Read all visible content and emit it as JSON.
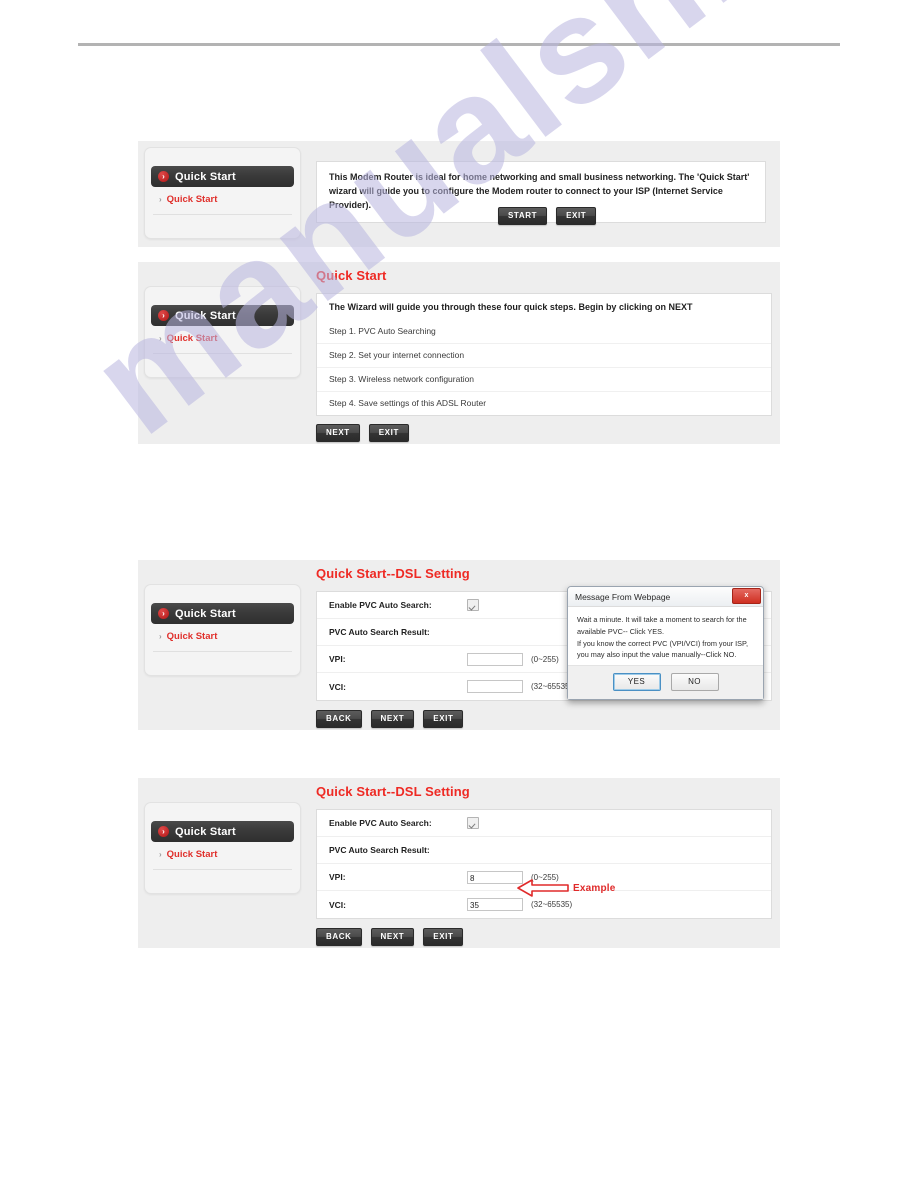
{
  "page": {
    "watermark": "manualshive.com"
  },
  "nav": {
    "main_label": "Quick Start",
    "sub_label": "Quick Start",
    "bullet": "chevron-right-icon"
  },
  "panel1": {
    "intro": "This Modem Router is ideal for home networking and small business networking. The 'Quick Start' wizard will guide you to configure the Modem router to connect to your ISP (Internet Service Provider).",
    "buttons": [
      "START",
      "EXIT"
    ]
  },
  "panel2": {
    "title": "Quick Start",
    "heading": "The Wizard will guide you through these four quick steps. Begin by clicking on NEXT",
    "steps": [
      "Step 1. PVC Auto Searching",
      "Step 2. Set your internet connection",
      "Step 3. Wireless network configuration",
      "Step 4. Save settings of this ADSL Router"
    ],
    "buttons": [
      "NEXT",
      "EXIT"
    ]
  },
  "panel3": {
    "title": "Quick Start--DSL Setting",
    "rows": {
      "enable_label": "Enable PVC Auto Search:",
      "result_label": "PVC Auto Search Result:",
      "vpi_label": "VPI:",
      "vpi_value": "",
      "vpi_range": "(0~255)",
      "vci_label": "VCI:",
      "vci_value": "",
      "vci_range": "(32~65535)"
    },
    "buttons": [
      "BACK",
      "NEXT",
      "EXIT"
    ],
    "dialog": {
      "title": "Message From Webpage",
      "close": "x",
      "line1": "Wait a minute. It will take a moment to search for the",
      "line2": "available PVC-- Click YES.",
      "line3": "If you know the correct PVC (VPI/VCI) from your ISP,",
      "line4": "you may also input the value manually--Click NO.",
      "yes": "YES",
      "no": "NO"
    }
  },
  "panel4": {
    "title": "Quick Start--DSL Setting",
    "rows": {
      "enable_label": "Enable PVC Auto Search:",
      "result_label": "PVC Auto Search Result:",
      "vpi_label": "VPI:",
      "vpi_value": "8",
      "vpi_range": "(0~255)",
      "vci_label": "VCI:",
      "vci_value": "35",
      "vci_range": "(32~65535)"
    },
    "buttons": [
      "BACK",
      "NEXT",
      "EXIT"
    ],
    "callout": {
      "label": "Example",
      "icon": "left-arrow-icon",
      "color": "#e02a2a"
    }
  }
}
